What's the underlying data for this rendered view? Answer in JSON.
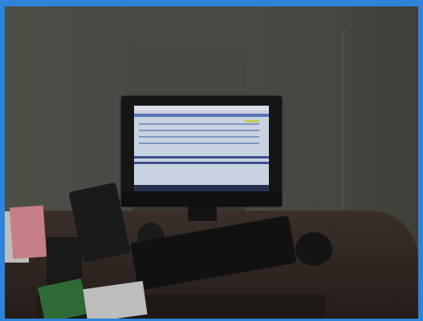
{
  "scene": {
    "frame_color": "#2f83d9",
    "wall_color": "#4a4b45",
    "desk_color": "#2f2622",
    "monitor_screen_color": "#c9d2e0"
  },
  "objects": {
    "monitor": "monitor",
    "keyboard": "keyboard",
    "mouse": "mouse",
    "printer": "printer",
    "papers": "papers",
    "stamp": "stamp",
    "green-book": "green-book",
    "receipt": "receipt",
    "wall-cable": "wall-cable"
  }
}
